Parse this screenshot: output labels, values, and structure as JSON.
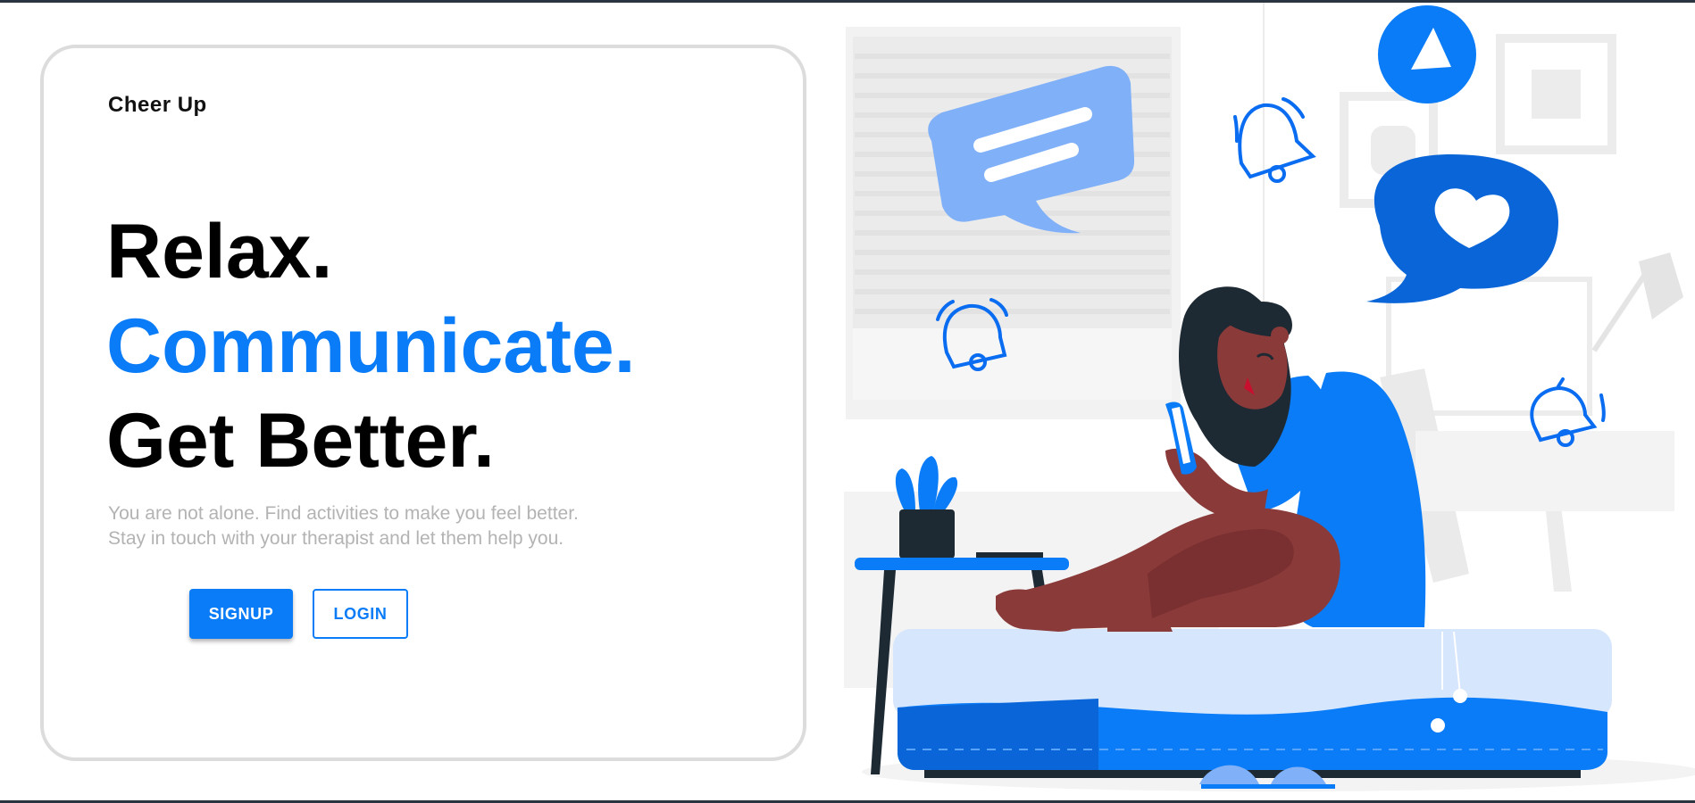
{
  "brand": {
    "name": "Cheer Up"
  },
  "hero": {
    "line1": "Relax.",
    "line2": "Communicate.",
    "line3": "Get Better.",
    "subtext_line1": "You are not alone. Find activities to make you feel better.",
    "subtext_line2": "Stay in touch with your therapist and let them help you."
  },
  "actions": {
    "signup_label": "SIGNUP",
    "login_label": "LOGIN"
  },
  "colors": {
    "accent": "#0a7cf7",
    "heading": "#000000",
    "subtext": "#b3b3b3",
    "card_border": "#dcdcdc"
  },
  "illustration": {
    "icons": [
      "chat-bubble-icon",
      "bell-icon",
      "play-icon",
      "heart-message-icon"
    ]
  }
}
